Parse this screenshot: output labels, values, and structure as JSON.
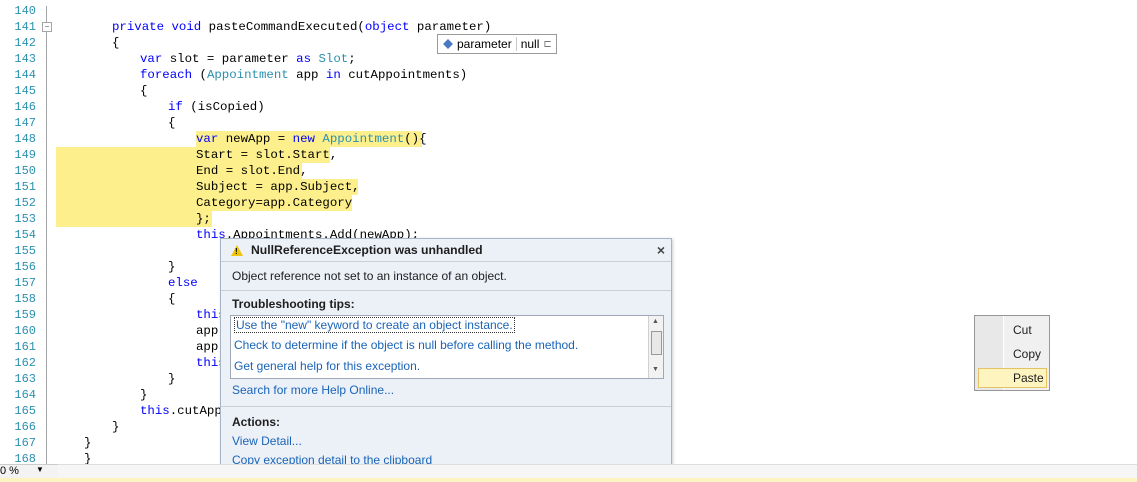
{
  "code": {
    "lines": [
      {
        "n": "140",
        "t": ""
      },
      {
        "n": "141",
        "t": "private void pasteCommandExecuted(object parameter)"
      },
      {
        "n": "142",
        "t": "{"
      },
      {
        "n": "143",
        "t": "var slot = parameter as Slot;"
      },
      {
        "n": "144",
        "t": "foreach (Appointment app in cutAppointments)"
      },
      {
        "n": "145",
        "t": "{"
      },
      {
        "n": "146",
        "t": "if (isCopied)"
      },
      {
        "n": "147",
        "t": "{"
      },
      {
        "n": "148",
        "t": "var newApp = new Appointment(){"
      },
      {
        "n": "149",
        "t": "Start = slot.Start,"
      },
      {
        "n": "150",
        "t": "End = slot.End,"
      },
      {
        "n": "151",
        "t": "Subject = app.Subject,"
      },
      {
        "n": "152",
        "t": "Category=app.Category"
      },
      {
        "n": "153",
        "t": "};"
      },
      {
        "n": "154",
        "t": "this.Appointments.Add(newApp);"
      },
      {
        "n": "155",
        "t": ""
      },
      {
        "n": "156",
        "t": "}"
      },
      {
        "n": "157",
        "t": "else"
      },
      {
        "n": "158",
        "t": "{"
      },
      {
        "n": "159",
        "t": "this"
      },
      {
        "n": "160",
        "t": "app."
      },
      {
        "n": "161",
        "t": "app."
      },
      {
        "n": "162",
        "t": "this"
      },
      {
        "n": "163",
        "t": "}"
      },
      {
        "n": "164",
        "t": "}"
      },
      {
        "n": "165",
        "t": "this.cutAppo"
      },
      {
        "n": "166",
        "t": "}"
      },
      {
        "n": "167",
        "t": "}"
      },
      {
        "n": "168",
        "t": "}"
      }
    ]
  },
  "datatip": {
    "name": "parameter",
    "value": "null",
    "icon": "variable-icon"
  },
  "exception": {
    "title": "NullReferenceException was unhandled",
    "message": "Object reference not set to an instance of an object.",
    "tips_header": "Troubleshooting tips:",
    "tips": [
      "Use the \"new\" keyword to create an object instance.",
      "Check to determine if the object is null before calling the method.",
      "Get general help for this exception."
    ],
    "search_link": "Search for more Help Online...",
    "actions_header": "Actions:",
    "actions": [
      "View Detail...",
      "Copy exception detail to the clipboard"
    ],
    "close": "×"
  },
  "context_menu": {
    "items": [
      "Cut",
      "Copy",
      "Paste"
    ],
    "hovered": "Paste"
  },
  "zoom": {
    "value": "0 %"
  },
  "colors": {
    "highlight": "#fdf08c",
    "keyword": "#0000ff",
    "type": "#2b91af",
    "link": "#1a64b8"
  }
}
